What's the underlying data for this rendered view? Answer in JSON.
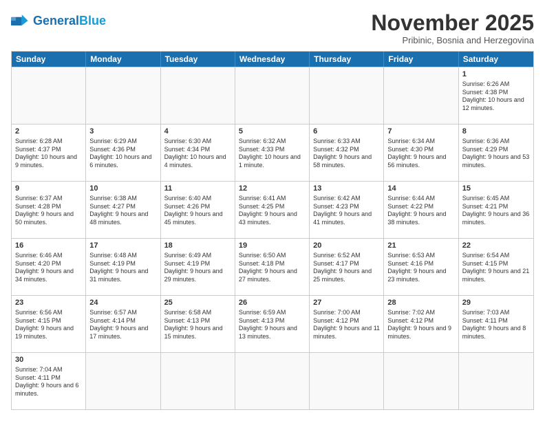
{
  "logo": {
    "general": "General",
    "blue": "Blue"
  },
  "title": "November 2025",
  "location": "Pribinic, Bosnia and Herzegovina",
  "days_of_week": [
    "Sunday",
    "Monday",
    "Tuesday",
    "Wednesday",
    "Thursday",
    "Friday",
    "Saturday"
  ],
  "weeks": [
    [
      {
        "day": "",
        "info": ""
      },
      {
        "day": "",
        "info": ""
      },
      {
        "day": "",
        "info": ""
      },
      {
        "day": "",
        "info": ""
      },
      {
        "day": "",
        "info": ""
      },
      {
        "day": "",
        "info": ""
      },
      {
        "day": "1",
        "info": "Sunrise: 6:26 AM\nSunset: 4:38 PM\nDaylight: 10 hours and 12 minutes."
      }
    ],
    [
      {
        "day": "2",
        "info": "Sunrise: 6:28 AM\nSunset: 4:37 PM\nDaylight: 10 hours and 9 minutes."
      },
      {
        "day": "3",
        "info": "Sunrise: 6:29 AM\nSunset: 4:36 PM\nDaylight: 10 hours and 6 minutes."
      },
      {
        "day": "4",
        "info": "Sunrise: 6:30 AM\nSunset: 4:34 PM\nDaylight: 10 hours and 4 minutes."
      },
      {
        "day": "5",
        "info": "Sunrise: 6:32 AM\nSunset: 4:33 PM\nDaylight: 10 hours and 1 minute."
      },
      {
        "day": "6",
        "info": "Sunrise: 6:33 AM\nSunset: 4:32 PM\nDaylight: 9 hours and 58 minutes."
      },
      {
        "day": "7",
        "info": "Sunrise: 6:34 AM\nSunset: 4:30 PM\nDaylight: 9 hours and 56 minutes."
      },
      {
        "day": "8",
        "info": "Sunrise: 6:36 AM\nSunset: 4:29 PM\nDaylight: 9 hours and 53 minutes."
      }
    ],
    [
      {
        "day": "9",
        "info": "Sunrise: 6:37 AM\nSunset: 4:28 PM\nDaylight: 9 hours and 50 minutes."
      },
      {
        "day": "10",
        "info": "Sunrise: 6:38 AM\nSunset: 4:27 PM\nDaylight: 9 hours and 48 minutes."
      },
      {
        "day": "11",
        "info": "Sunrise: 6:40 AM\nSunset: 4:26 PM\nDaylight: 9 hours and 45 minutes."
      },
      {
        "day": "12",
        "info": "Sunrise: 6:41 AM\nSunset: 4:25 PM\nDaylight: 9 hours and 43 minutes."
      },
      {
        "day": "13",
        "info": "Sunrise: 6:42 AM\nSunset: 4:23 PM\nDaylight: 9 hours and 41 minutes."
      },
      {
        "day": "14",
        "info": "Sunrise: 6:44 AM\nSunset: 4:22 PM\nDaylight: 9 hours and 38 minutes."
      },
      {
        "day": "15",
        "info": "Sunrise: 6:45 AM\nSunset: 4:21 PM\nDaylight: 9 hours and 36 minutes."
      }
    ],
    [
      {
        "day": "16",
        "info": "Sunrise: 6:46 AM\nSunset: 4:20 PM\nDaylight: 9 hours and 34 minutes."
      },
      {
        "day": "17",
        "info": "Sunrise: 6:48 AM\nSunset: 4:19 PM\nDaylight: 9 hours and 31 minutes."
      },
      {
        "day": "18",
        "info": "Sunrise: 6:49 AM\nSunset: 4:19 PM\nDaylight: 9 hours and 29 minutes."
      },
      {
        "day": "19",
        "info": "Sunrise: 6:50 AM\nSunset: 4:18 PM\nDaylight: 9 hours and 27 minutes."
      },
      {
        "day": "20",
        "info": "Sunrise: 6:52 AM\nSunset: 4:17 PM\nDaylight: 9 hours and 25 minutes."
      },
      {
        "day": "21",
        "info": "Sunrise: 6:53 AM\nSunset: 4:16 PM\nDaylight: 9 hours and 23 minutes."
      },
      {
        "day": "22",
        "info": "Sunrise: 6:54 AM\nSunset: 4:15 PM\nDaylight: 9 hours and 21 minutes."
      }
    ],
    [
      {
        "day": "23",
        "info": "Sunrise: 6:56 AM\nSunset: 4:15 PM\nDaylight: 9 hours and 19 minutes."
      },
      {
        "day": "24",
        "info": "Sunrise: 6:57 AM\nSunset: 4:14 PM\nDaylight: 9 hours and 17 minutes."
      },
      {
        "day": "25",
        "info": "Sunrise: 6:58 AM\nSunset: 4:13 PM\nDaylight: 9 hours and 15 minutes."
      },
      {
        "day": "26",
        "info": "Sunrise: 6:59 AM\nSunset: 4:13 PM\nDaylight: 9 hours and 13 minutes."
      },
      {
        "day": "27",
        "info": "Sunrise: 7:00 AM\nSunset: 4:12 PM\nDaylight: 9 hours and 11 minutes."
      },
      {
        "day": "28",
        "info": "Sunrise: 7:02 AM\nSunset: 4:12 PM\nDaylight: 9 hours and 9 minutes."
      },
      {
        "day": "29",
        "info": "Sunrise: 7:03 AM\nSunset: 4:11 PM\nDaylight: 9 hours and 8 minutes."
      }
    ],
    [
      {
        "day": "30",
        "info": "Sunrise: 7:04 AM\nSunset: 4:11 PM\nDaylight: 9 hours and 6 minutes."
      },
      {
        "day": "",
        "info": ""
      },
      {
        "day": "",
        "info": ""
      },
      {
        "day": "",
        "info": ""
      },
      {
        "day": "",
        "info": ""
      },
      {
        "day": "",
        "info": ""
      },
      {
        "day": "",
        "info": ""
      }
    ]
  ]
}
